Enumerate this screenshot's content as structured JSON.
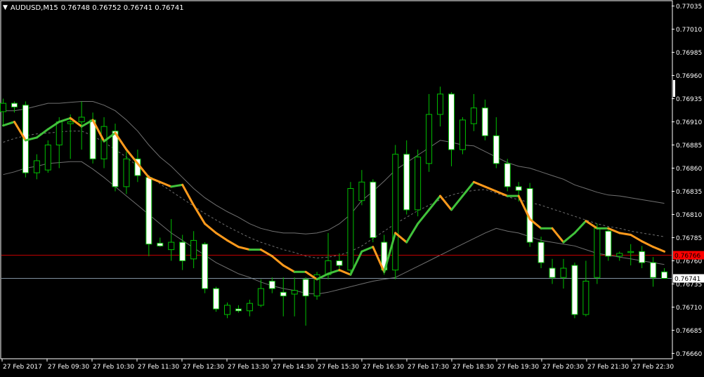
{
  "header": {
    "symbol": "AUDUSD,M15",
    "ohlc": "0.76748 0.76752 0.76741 0.76741",
    "menu_icon": "triangle-down-icon"
  },
  "colors": {
    "background": "#000000",
    "bull_wick": "#00c000",
    "bull_body": "#000000",
    "bull_border": "#00c000",
    "bear_body": "#ffffff",
    "bear_border": "#00c000",
    "ma_up": "#41c23b",
    "ma_down": "#ff9a1c",
    "band": "#707070",
    "axis_text": "#ffffff",
    "red_line": "#c00000",
    "bid_line": "#8090a0",
    "red_label_bg": "#ff0000"
  },
  "price_axis": {
    "labels": [
      "0.77035",
      "0.77010",
      "0.76985",
      "0.76960",
      "0.76935",
      "0.76910",
      "0.76885",
      "0.76860",
      "0.76835",
      "0.76810",
      "0.76785",
      "0.76760",
      "0.76735",
      "0.76710",
      "0.76685",
      "0.76660"
    ],
    "red_line_label": "0.76766",
    "bid_label": "0.76741"
  },
  "time_axis": {
    "labels": [
      "27 Feb 2017",
      "27 Feb 09:30",
      "27 Feb 10:30",
      "27 Feb 11:30",
      "27 Feb 12:30",
      "27 Feb 13:30",
      "27 Feb 14:30",
      "27 Feb 15:30",
      "27 Feb 16:30",
      "27 Feb 17:30",
      "27 Feb 18:30",
      "27 Feb 19:30",
      "27 Feb 20:30",
      "27 Feb 21:30",
      "27 Feb 22:30"
    ]
  },
  "chart_data": {
    "type": "candlestick",
    "y_range": [
      0.76655,
      0.7704
    ],
    "red_level": 0.76766,
    "bid": 0.76741,
    "candles": [
      {
        "o": 0.76921,
        "h": 0.76935,
        "l": 0.76905,
        "c": 0.7693
      },
      {
        "o": 0.7693,
        "h": 0.76932,
        "l": 0.7692,
        "c": 0.76926
      },
      {
        "o": 0.76928,
        "h": 0.76932,
        "l": 0.7685,
        "c": 0.76855
      },
      {
        "o": 0.76855,
        "h": 0.76875,
        "l": 0.76848,
        "c": 0.76868
      },
      {
        "o": 0.76858,
        "h": 0.7689,
        "l": 0.76855,
        "c": 0.76885
      },
      {
        "o": 0.76885,
        "h": 0.76915,
        "l": 0.7686,
        "c": 0.7691
      },
      {
        "o": 0.76908,
        "h": 0.76918,
        "l": 0.7687,
        "c": 0.7691
      },
      {
        "o": 0.7691,
        "h": 0.76932,
        "l": 0.7688,
        "c": 0.76915
      },
      {
        "o": 0.76912,
        "h": 0.7692,
        "l": 0.76865,
        "c": 0.7687
      },
      {
        "o": 0.7687,
        "h": 0.76915,
        "l": 0.7686,
        "c": 0.76905
      },
      {
        "o": 0.769,
        "h": 0.76908,
        "l": 0.76835,
        "c": 0.7684
      },
      {
        "o": 0.7684,
        "h": 0.76878,
        "l": 0.76832,
        "c": 0.7687
      },
      {
        "o": 0.7687,
        "h": 0.7688,
        "l": 0.76845,
        "c": 0.76852
      },
      {
        "o": 0.7685,
        "h": 0.76852,
        "l": 0.76765,
        "c": 0.76778
      },
      {
        "o": 0.76779,
        "h": 0.76785,
        "l": 0.76775,
        "c": 0.76776
      },
      {
        "o": 0.76772,
        "h": 0.76805,
        "l": 0.7676,
        "c": 0.7678
      },
      {
        "o": 0.7678,
        "h": 0.76788,
        "l": 0.7675,
        "c": 0.7676
      },
      {
        "o": 0.76762,
        "h": 0.76792,
        "l": 0.76752,
        "c": 0.76782
      },
      {
        "o": 0.76778,
        "h": 0.7678,
        "l": 0.76725,
        "c": 0.7673
      },
      {
        "o": 0.7673,
        "h": 0.76732,
        "l": 0.76705,
        "c": 0.76708
      },
      {
        "o": 0.76702,
        "h": 0.76715,
        "l": 0.76698,
        "c": 0.76712
      },
      {
        "o": 0.76708,
        "h": 0.76712,
        "l": 0.76704,
        "c": 0.76706
      },
      {
        "o": 0.76706,
        "h": 0.76718,
        "l": 0.767,
        "c": 0.76714
      },
      {
        "o": 0.76712,
        "h": 0.7674,
        "l": 0.7671,
        "c": 0.7673
      },
      {
        "o": 0.76738,
        "h": 0.76742,
        "l": 0.76725,
        "c": 0.7673
      },
      {
        "o": 0.76726,
        "h": 0.76742,
        "l": 0.767,
        "c": 0.76722
      },
      {
        "o": 0.76724,
        "h": 0.76742,
        "l": 0.767,
        "c": 0.76728
      },
      {
        "o": 0.7674,
        "h": 0.76742,
        "l": 0.7669,
        "c": 0.76722
      },
      {
        "o": 0.76722,
        "h": 0.76748,
        "l": 0.76718,
        "c": 0.76745
      },
      {
        "o": 0.76745,
        "h": 0.7679,
        "l": 0.7674,
        "c": 0.7676
      },
      {
        "o": 0.7676,
        "h": 0.76768,
        "l": 0.76748,
        "c": 0.76755
      },
      {
        "o": 0.7675,
        "h": 0.76845,
        "l": 0.76746,
        "c": 0.76838
      },
      {
        "o": 0.76825,
        "h": 0.76858,
        "l": 0.7682,
        "c": 0.76845
      },
      {
        "o": 0.76845,
        "h": 0.76848,
        "l": 0.7678,
        "c": 0.76785
      },
      {
        "o": 0.7678,
        "h": 0.76788,
        "l": 0.76745,
        "c": 0.7675
      },
      {
        "o": 0.7675,
        "h": 0.76885,
        "l": 0.7674,
        "c": 0.76875
      },
      {
        "o": 0.76875,
        "h": 0.7689,
        "l": 0.7681,
        "c": 0.76815
      },
      {
        "o": 0.76815,
        "h": 0.7688,
        "l": 0.76808,
        "c": 0.76872
      },
      {
        "o": 0.76865,
        "h": 0.7694,
        "l": 0.76856,
        "c": 0.76918
      },
      {
        "o": 0.76918,
        "h": 0.76948,
        "l": 0.76905,
        "c": 0.7694
      },
      {
        "o": 0.7694,
        "h": 0.76942,
        "l": 0.76862,
        "c": 0.7688
      },
      {
        "o": 0.7688,
        "h": 0.76915,
        "l": 0.76875,
        "c": 0.76912
      },
      {
        "o": 0.76908,
        "h": 0.7694,
        "l": 0.769,
        "c": 0.76925
      },
      {
        "o": 0.76925,
        "h": 0.76934,
        "l": 0.7689,
        "c": 0.76895
      },
      {
        "o": 0.76895,
        "h": 0.76915,
        "l": 0.7686,
        "c": 0.76865
      },
      {
        "o": 0.76865,
        "h": 0.7687,
        "l": 0.76835,
        "c": 0.7684
      },
      {
        "o": 0.7684,
        "h": 0.76845,
        "l": 0.76824,
        "c": 0.76836
      },
      {
        "o": 0.76838,
        "h": 0.76844,
        "l": 0.76775,
        "c": 0.7678
      },
      {
        "o": 0.7678,
        "h": 0.76786,
        "l": 0.76752,
        "c": 0.76758
      },
      {
        "o": 0.76752,
        "h": 0.76762,
        "l": 0.76735,
        "c": 0.76742
      },
      {
        "o": 0.76742,
        "h": 0.76762,
        "l": 0.7673,
        "c": 0.76752
      },
      {
        "o": 0.76755,
        "h": 0.76758,
        "l": 0.76698,
        "c": 0.76702
      },
      {
        "o": 0.76702,
        "h": 0.7676,
        "l": 0.767,
        "c": 0.76738
      },
      {
        "o": 0.76742,
        "h": 0.768,
        "l": 0.76735,
        "c": 0.76795
      },
      {
        "o": 0.76792,
        "h": 0.76796,
        "l": 0.7676,
        "c": 0.76765
      },
      {
        "o": 0.76765,
        "h": 0.7677,
        "l": 0.7676,
        "c": 0.76768
      },
      {
        "o": 0.76769,
        "h": 0.76778,
        "l": 0.76755,
        "c": 0.7677
      },
      {
        "o": 0.7677,
        "h": 0.76776,
        "l": 0.76752,
        "c": 0.76758
      },
      {
        "o": 0.76758,
        "h": 0.76764,
        "l": 0.76732,
        "c": 0.76742
      },
      {
        "o": 0.76748,
        "h": 0.76752,
        "l": 0.76741,
        "c": 0.76741
      }
    ],
    "ma": [
      0.76906,
      0.7691,
      0.7689,
      0.76893,
      0.76902,
      0.7691,
      0.76914,
      0.76905,
      0.76912,
      0.76889,
      0.76898,
      0.7688,
      0.76865,
      0.7685,
      0.76845,
      0.7684,
      0.76842,
      0.7682,
      0.768,
      0.7679,
      0.76782,
      0.76775,
      0.76772,
      0.76772,
      0.76765,
      0.76755,
      0.76748,
      0.76748,
      0.7674,
      0.76746,
      0.7675,
      0.76745,
      0.7677,
      0.76775,
      0.76748,
      0.7679,
      0.7678,
      0.768,
      0.76815,
      0.7683,
      0.76815,
      0.7683,
      0.76845,
      0.7684,
      0.76835,
      0.7683,
      0.7683,
      0.76805,
      0.76795,
      0.76795,
      0.7678,
      0.7679,
      0.76803,
      0.76795,
      0.76795,
      0.7679,
      0.76788,
      0.76781,
      0.76775,
      0.7677
    ],
    "band_upper": [
      0.76922,
      0.76922,
      0.76924,
      0.76927,
      0.7693,
      0.7693,
      0.76931,
      0.76932,
      0.76932,
      0.76928,
      0.76922,
      0.76912,
      0.769,
      0.76885,
      0.76872,
      0.76862,
      0.7685,
      0.76838,
      0.76828,
      0.7682,
      0.76813,
      0.76807,
      0.768,
      0.76795,
      0.76792,
      0.7679,
      0.7679,
      0.76789,
      0.7679,
      0.76793,
      0.768,
      0.7681,
      0.76825,
      0.76835,
      0.76846,
      0.76858,
      0.76866,
      0.76874,
      0.76882,
      0.7689,
      0.76888,
      0.76885,
      0.76884,
      0.76878,
      0.76872,
      0.76866,
      0.76862,
      0.7686,
      0.76856,
      0.76852,
      0.76848,
      0.76842,
      0.76838,
      0.76834,
      0.76831,
      0.7683,
      0.76828,
      0.76826,
      0.76824,
      0.76822
    ],
    "band_mid": [
      0.76888,
      0.76892,
      0.76895,
      0.76897,
      0.76898,
      0.76899,
      0.769,
      0.769,
      0.76895,
      0.76888,
      0.7688,
      0.76872,
      0.76862,
      0.76852,
      0.76843,
      0.76835,
      0.76827,
      0.76819,
      0.76811,
      0.76804,
      0.76797,
      0.76791,
      0.76785,
      0.7678,
      0.76776,
      0.76772,
      0.76769,
      0.76765,
      0.76763,
      0.76764,
      0.76766,
      0.7677,
      0.76776,
      0.76784,
      0.76792,
      0.768,
      0.76807,
      0.76814,
      0.7682,
      0.76826,
      0.76831,
      0.76834,
      0.76836,
      0.76837,
      0.76833,
      0.76829,
      0.76826,
      0.76823,
      0.7682,
      0.76816,
      0.76812,
      0.76808,
      0.76804,
      0.768,
      0.76797,
      0.76795,
      0.76792,
      0.7679,
      0.76788,
      0.76786
    ],
    "band_lower": [
      0.76853,
      0.76856,
      0.7686,
      0.76862,
      0.76865,
      0.76866,
      0.76867,
      0.76867,
      0.76859,
      0.7685,
      0.7684,
      0.7683,
      0.7682,
      0.7681,
      0.768,
      0.7679,
      0.76782,
      0.76774,
      0.76766,
      0.76758,
      0.76752,
      0.76746,
      0.76742,
      0.76737,
      0.76733,
      0.7673,
      0.76728,
      0.76725,
      0.76724,
      0.76726,
      0.76729,
      0.76732,
      0.76735,
      0.76738,
      0.7674,
      0.76742,
      0.76748,
      0.76754,
      0.7676,
      0.76766,
      0.76772,
      0.76778,
      0.76784,
      0.7679,
      0.76795,
      0.76792,
      0.7679,
      0.76786,
      0.76782,
      0.7678,
      0.76778,
      0.76776,
      0.76772,
      0.76768,
      0.76766,
      0.76764,
      0.76762,
      0.7676,
      0.76758,
      0.76756
    ]
  }
}
